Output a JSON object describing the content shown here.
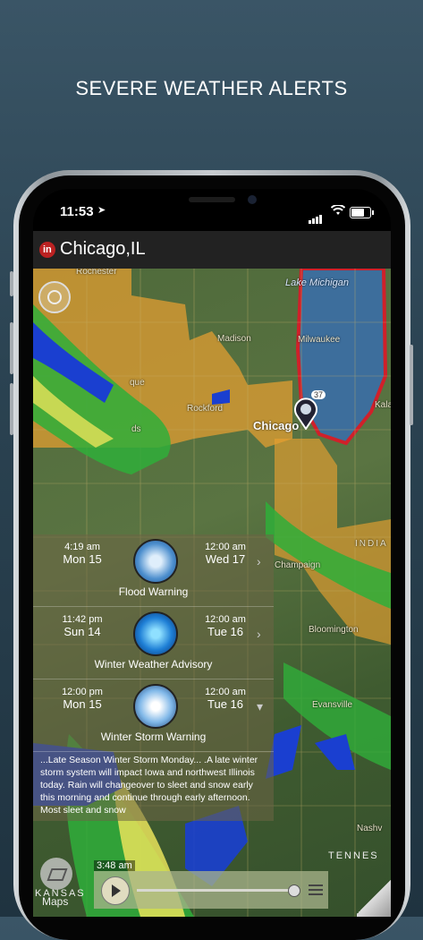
{
  "headline": "SEVERE WEATHER ALERTS",
  "status": {
    "time": "11:53",
    "location_arrow": "➤"
  },
  "app": {
    "city": "Chicago,IL",
    "logo_letter": "in"
  },
  "map": {
    "labels": {
      "lake_michigan": "Lake Michigan",
      "milwaukee": "Milwaukee",
      "madison": "Madison",
      "rockford": "Rockford",
      "chicago": "Chicago",
      "champaign": "Champaign",
      "bloomington": "Bloomington",
      "evansville": "Evansville",
      "nashville": "Nashv",
      "indiana": "INDIA",
      "tennessee": "TENNES",
      "kansas": "KANSAS",
      "kala": "Kala",
      "rochester": "Rochester",
      "dubuque": "que",
      "iowa_city": "ds"
    },
    "pin_badge": "37"
  },
  "alerts": [
    {
      "start_time": "4:19 am",
      "start_day": "Mon 15",
      "end_time": "12:00 am",
      "end_day": "Wed 17",
      "title": "Flood Warning",
      "icon": "flood-icon",
      "chevron": "›"
    },
    {
      "start_time": "11:42 pm",
      "start_day": "Sun 14",
      "end_time": "12:00 am",
      "end_day": "Tue 16",
      "title": "Winter Weather Advisory",
      "icon": "winter-advisory-icon",
      "chevron": "›"
    },
    {
      "start_time": "12:00 pm",
      "start_day": "Mon 15",
      "end_time": "12:00 am",
      "end_day": "Tue 16",
      "title": "Winter Storm Warning",
      "icon": "snowflake-icon",
      "chevron": "▾"
    }
  ],
  "alert_text": "...Late Season Winter Storm Monday... .A late winter storm system will impact Iowa and northwest Illinois today. Rain will changeover to sleet and snow early this morning and continue through early afternoon. Most sleet and snow",
  "player": {
    "clock": "3:48 am",
    "progress": 0.97
  },
  "maps_attribution": "Maps",
  "colors": {
    "warning_orange": "#e8a030",
    "lake": "#3d6e9c",
    "red_outline": "#d0202a"
  }
}
